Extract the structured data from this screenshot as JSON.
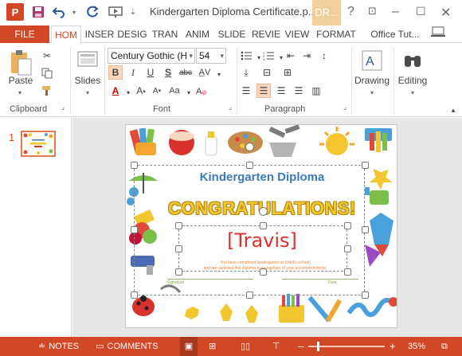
{
  "title_bar": {
    "app_icon_letter": "P",
    "document_title": "Kindergarten Diploma Certificate.p...",
    "contextual_tab_title": "DR..."
  },
  "tabs": [
    {
      "label": "FILE"
    },
    {
      "label": "HOM"
    },
    {
      "label": "INSER"
    },
    {
      "label": "DESIG"
    },
    {
      "label": "TRAN"
    },
    {
      "label": "ANIM"
    },
    {
      "label": "SLIDE"
    },
    {
      "label": "REVIE"
    },
    {
      "label": "VIEW"
    },
    {
      "label": "FORMAT"
    }
  ],
  "account_label": "Office Tut...",
  "ribbon": {
    "paste_label": "Paste",
    "slides_label": "Slides",
    "font_name": "Century Gothic (H",
    "font_size": "54",
    "drawing_label": "Drawing",
    "editing_label": "Editing",
    "group_clipboard": "Clipboard",
    "group_font": "Font",
    "group_paragraph": "Paragraph"
  },
  "thumbnails": {
    "slide_number": "1"
  },
  "slide": {
    "diploma_title": "Kindergarten Diploma",
    "congrats": "CONGRATULATIONS!",
    "recipient": "[Travis]",
    "body_line1": "You have completed kindergarten at [child's school]",
    "body_line2": "and are awarded this diploma in recognition of your accomplishments.",
    "signature_label": "Signature",
    "date_label": "Date"
  },
  "status_bar": {
    "notes_label": "NOTES",
    "comments_label": "COMMENTS",
    "zoom": "35%"
  },
  "colors": {
    "accent": "#d24726",
    "contextual_tab": "#f0cf9a"
  }
}
